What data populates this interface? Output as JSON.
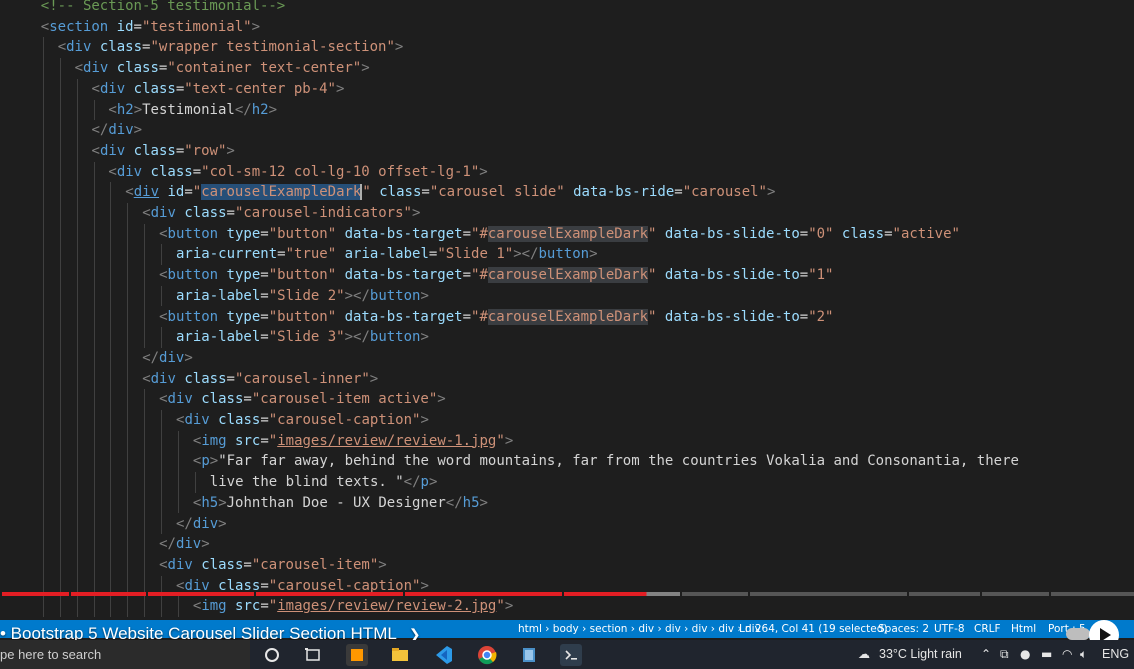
{
  "editor": {
    "lines": [
      {
        "indent": 2,
        "tokens": [
          {
            "t": "<!-- Section-5 testimonial-->",
            "c": "c"
          }
        ]
      },
      {
        "indent": 2,
        "tokens": [
          {
            "t": "<",
            "c": "p"
          },
          {
            "t": "section",
            "c": "t"
          },
          {
            "t": " id",
            "c": "a"
          },
          {
            "t": "=",
            "c": "x"
          },
          {
            "t": "\"testimonial\"",
            "c": "s"
          },
          {
            "t": ">",
            "c": "p"
          }
        ]
      },
      {
        "indent": 3,
        "tokens": [
          {
            "t": "<",
            "c": "p"
          },
          {
            "t": "div",
            "c": "t"
          },
          {
            "t": " class",
            "c": "a"
          },
          {
            "t": "=",
            "c": "x"
          },
          {
            "t": "\"wrapper testimonial-section\"",
            "c": "s"
          },
          {
            "t": ">",
            "c": "p"
          }
        ]
      },
      {
        "indent": 4,
        "tokens": [
          {
            "t": "<",
            "c": "p"
          },
          {
            "t": "div",
            "c": "t"
          },
          {
            "t": " class",
            "c": "a"
          },
          {
            "t": "=",
            "c": "x"
          },
          {
            "t": "\"container text-center\"",
            "c": "s"
          },
          {
            "t": ">",
            "c": "p"
          }
        ]
      },
      {
        "indent": 5,
        "tokens": [
          {
            "t": "<",
            "c": "p"
          },
          {
            "t": "div",
            "c": "t"
          },
          {
            "t": " class",
            "c": "a"
          },
          {
            "t": "=",
            "c": "x"
          },
          {
            "t": "\"text-center pb-4\"",
            "c": "s"
          },
          {
            "t": ">",
            "c": "p"
          }
        ]
      },
      {
        "indent": 6,
        "tokens": [
          {
            "t": "<",
            "c": "p"
          },
          {
            "t": "h2",
            "c": "t"
          },
          {
            "t": ">",
            "c": "p"
          },
          {
            "t": "Testimonial",
            "c": "x"
          },
          {
            "t": "</",
            "c": "p"
          },
          {
            "t": "h2",
            "c": "t"
          },
          {
            "t": ">",
            "c": "p"
          }
        ]
      },
      {
        "indent": 5,
        "tokens": [
          {
            "t": "</",
            "c": "p"
          },
          {
            "t": "div",
            "c": "t"
          },
          {
            "t": ">",
            "c": "p"
          }
        ]
      },
      {
        "indent": 5,
        "tokens": [
          {
            "t": "<",
            "c": "p"
          },
          {
            "t": "div",
            "c": "t"
          },
          {
            "t": " class",
            "c": "a"
          },
          {
            "t": "=",
            "c": "x"
          },
          {
            "t": "\"row\"",
            "c": "s"
          },
          {
            "t": ">",
            "c": "p"
          }
        ]
      },
      {
        "indent": 6,
        "tokens": [
          {
            "t": "<",
            "c": "p"
          },
          {
            "t": "div",
            "c": "t"
          },
          {
            "t": " class",
            "c": "a"
          },
          {
            "t": "=",
            "c": "x"
          },
          {
            "t": "\"col-sm-12 col-lg-10 offset-lg-1\"",
            "c": "s"
          },
          {
            "t": ">",
            "c": "p"
          }
        ]
      },
      {
        "indent": 7,
        "tokens": [
          {
            "t": "<",
            "c": "p"
          },
          {
            "t": "div",
            "c": "t u"
          },
          {
            "t": " id",
            "c": "a"
          },
          {
            "t": "=",
            "c": "x"
          },
          {
            "t": "\"",
            "c": "s"
          },
          {
            "t": "carouselExampleDark",
            "c": "s sel"
          },
          {
            "t": "|",
            "c": "cursor"
          },
          {
            "t": "\"",
            "c": "s"
          },
          {
            "t": " class",
            "c": "a"
          },
          {
            "t": "=",
            "c": "x"
          },
          {
            "t": "\"carousel slide\"",
            "c": "s"
          },
          {
            "t": " data-bs-ride",
            "c": "a"
          },
          {
            "t": "=",
            "c": "x"
          },
          {
            "t": "\"carousel\"",
            "c": "s"
          },
          {
            "t": ">",
            "c": "p"
          }
        ]
      },
      {
        "indent": 8,
        "tokens": [
          {
            "t": "<",
            "c": "p"
          },
          {
            "t": "div",
            "c": "t"
          },
          {
            "t": " class",
            "c": "a"
          },
          {
            "t": "=",
            "c": "x"
          },
          {
            "t": "\"carousel-indicators\"",
            "c": "s"
          },
          {
            "t": ">",
            "c": "p"
          }
        ]
      },
      {
        "indent": 9,
        "tokens": [
          {
            "t": "<",
            "c": "p"
          },
          {
            "t": "button",
            "c": "t"
          },
          {
            "t": " type",
            "c": "a"
          },
          {
            "t": "=",
            "c": "x"
          },
          {
            "t": "\"button\"",
            "c": "s"
          },
          {
            "t": " data-bs-target",
            "c": "a"
          },
          {
            "t": "=",
            "c": "x"
          },
          {
            "t": "\"#",
            "c": "s"
          },
          {
            "t": "carouselExampleDark",
            "c": "s hl"
          },
          {
            "t": "\"",
            "c": "s"
          },
          {
            "t": " data-bs-slide-to",
            "c": "a"
          },
          {
            "t": "=",
            "c": "x"
          },
          {
            "t": "\"0\"",
            "c": "s"
          },
          {
            "t": " class",
            "c": "a"
          },
          {
            "t": "=",
            "c": "x"
          },
          {
            "t": "\"active\"",
            "c": "s"
          }
        ]
      },
      {
        "indent": 10,
        "tokens": [
          {
            "t": "aria-current",
            "c": "a"
          },
          {
            "t": "=",
            "c": "x"
          },
          {
            "t": "\"true\"",
            "c": "s"
          },
          {
            "t": " aria-label",
            "c": "a"
          },
          {
            "t": "=",
            "c": "x"
          },
          {
            "t": "\"Slide 1\"",
            "c": "s"
          },
          {
            "t": "></",
            "c": "p"
          },
          {
            "t": "button",
            "c": "t"
          },
          {
            "t": ">",
            "c": "p"
          }
        ]
      },
      {
        "indent": 9,
        "tokens": [
          {
            "t": "<",
            "c": "p"
          },
          {
            "t": "button",
            "c": "t"
          },
          {
            "t": " type",
            "c": "a"
          },
          {
            "t": "=",
            "c": "x"
          },
          {
            "t": "\"button\"",
            "c": "s"
          },
          {
            "t": " data-bs-target",
            "c": "a"
          },
          {
            "t": "=",
            "c": "x"
          },
          {
            "t": "\"#",
            "c": "s"
          },
          {
            "t": "carouselExampleDark",
            "c": "s hl"
          },
          {
            "t": "\"",
            "c": "s"
          },
          {
            "t": " data-bs-slide-to",
            "c": "a"
          },
          {
            "t": "=",
            "c": "x"
          },
          {
            "t": "\"1\"",
            "c": "s"
          }
        ]
      },
      {
        "indent": 10,
        "tokens": [
          {
            "t": "aria-label",
            "c": "a"
          },
          {
            "t": "=",
            "c": "x"
          },
          {
            "t": "\"Slide 2\"",
            "c": "s"
          },
          {
            "t": "></",
            "c": "p"
          },
          {
            "t": "button",
            "c": "t"
          },
          {
            "t": ">",
            "c": "p"
          }
        ]
      },
      {
        "indent": 9,
        "tokens": [
          {
            "t": "<",
            "c": "p"
          },
          {
            "t": "button",
            "c": "t"
          },
          {
            "t": " type",
            "c": "a"
          },
          {
            "t": "=",
            "c": "x"
          },
          {
            "t": "\"button\"",
            "c": "s"
          },
          {
            "t": " data-bs-target",
            "c": "a"
          },
          {
            "t": "=",
            "c": "x"
          },
          {
            "t": "\"#",
            "c": "s"
          },
          {
            "t": "carouselExampleDark",
            "c": "s hl"
          },
          {
            "t": "\"",
            "c": "s"
          },
          {
            "t": " data-bs-slide-to",
            "c": "a"
          },
          {
            "t": "=",
            "c": "x"
          },
          {
            "t": "\"2\"",
            "c": "s"
          }
        ]
      },
      {
        "indent": 10,
        "tokens": [
          {
            "t": "aria-label",
            "c": "a"
          },
          {
            "t": "=",
            "c": "x"
          },
          {
            "t": "\"Slide 3\"",
            "c": "s"
          },
          {
            "t": "></",
            "c": "p"
          },
          {
            "t": "button",
            "c": "t"
          },
          {
            "t": ">",
            "c": "p"
          }
        ]
      },
      {
        "indent": 8,
        "tokens": [
          {
            "t": "</",
            "c": "p"
          },
          {
            "t": "div",
            "c": "t"
          },
          {
            "t": ">",
            "c": "p"
          }
        ]
      },
      {
        "indent": 8,
        "tokens": [
          {
            "t": "<",
            "c": "p"
          },
          {
            "t": "div",
            "c": "t"
          },
          {
            "t": " class",
            "c": "a"
          },
          {
            "t": "=",
            "c": "x"
          },
          {
            "t": "\"carousel-inner\"",
            "c": "s"
          },
          {
            "t": ">",
            "c": "p"
          }
        ]
      },
      {
        "indent": 9,
        "tokens": [
          {
            "t": "<",
            "c": "p"
          },
          {
            "t": "div",
            "c": "t"
          },
          {
            "t": " class",
            "c": "a"
          },
          {
            "t": "=",
            "c": "x"
          },
          {
            "t": "\"carousel-item active\"",
            "c": "s"
          },
          {
            "t": ">",
            "c": "p"
          }
        ]
      },
      {
        "indent": 10,
        "tokens": [
          {
            "t": "<",
            "c": "p"
          },
          {
            "t": "div",
            "c": "t"
          },
          {
            "t": " class",
            "c": "a"
          },
          {
            "t": "=",
            "c": "x"
          },
          {
            "t": "\"carousel-caption\"",
            "c": "s"
          },
          {
            "t": ">",
            "c": "p"
          }
        ]
      },
      {
        "indent": 11,
        "tokens": [
          {
            "t": "<",
            "c": "p"
          },
          {
            "t": "img",
            "c": "t"
          },
          {
            "t": " src",
            "c": "a"
          },
          {
            "t": "=",
            "c": "x"
          },
          {
            "t": "\"",
            "c": "s"
          },
          {
            "t": "images/review/review-1.jpg",
            "c": "s u"
          },
          {
            "t": "\"",
            "c": "s"
          },
          {
            "t": ">",
            "c": "p"
          }
        ]
      },
      {
        "indent": 11,
        "tokens": [
          {
            "t": "<",
            "c": "p"
          },
          {
            "t": "p",
            "c": "t"
          },
          {
            "t": ">",
            "c": "p"
          },
          {
            "t": "\"Far far away, behind the word mountains, far from the countries Vokalia and Consonantia, there",
            "c": "x"
          }
        ]
      },
      {
        "indent": 12,
        "tokens": [
          {
            "t": "live the blind texts. \"",
            "c": "x"
          },
          {
            "t": "</",
            "c": "p"
          },
          {
            "t": "p",
            "c": "t"
          },
          {
            "t": ">",
            "c": "p"
          }
        ]
      },
      {
        "indent": 11,
        "tokens": [
          {
            "t": "<",
            "c": "p"
          },
          {
            "t": "h5",
            "c": "t"
          },
          {
            "t": ">",
            "c": "p"
          },
          {
            "t": "Johnthan Doe - UX Designer",
            "c": "x"
          },
          {
            "t": "</",
            "c": "p"
          },
          {
            "t": "h5",
            "c": "t"
          },
          {
            "t": ">",
            "c": "p"
          }
        ]
      },
      {
        "indent": 10,
        "tokens": [
          {
            "t": "</",
            "c": "p"
          },
          {
            "t": "div",
            "c": "t"
          },
          {
            "t": ">",
            "c": "p"
          }
        ]
      },
      {
        "indent": 9,
        "tokens": [
          {
            "t": "</",
            "c": "p"
          },
          {
            "t": "div",
            "c": "t"
          },
          {
            "t": ">",
            "c": "p"
          }
        ]
      },
      {
        "indent": 9,
        "tokens": [
          {
            "t": "<",
            "c": "p"
          },
          {
            "t": "div",
            "c": "t"
          },
          {
            "t": " class",
            "c": "a"
          },
          {
            "t": "=",
            "c": "x"
          },
          {
            "t": "\"carousel-item\"",
            "c": "s"
          },
          {
            "t": ">",
            "c": "p"
          }
        ]
      },
      {
        "indent": 10,
        "tokens": [
          {
            "t": "<",
            "c": "p"
          },
          {
            "t": "div",
            "c": "t"
          },
          {
            "t": " class",
            "c": "a"
          },
          {
            "t": "=",
            "c": "x"
          },
          {
            "t": "\"carousel-caption\"",
            "c": "s"
          },
          {
            "t": ">",
            "c": "p"
          }
        ]
      },
      {
        "indent": 11,
        "tokens": [
          {
            "t": "<",
            "c": "p"
          },
          {
            "t": "img",
            "c": "t"
          },
          {
            "t": " src",
            "c": "a"
          },
          {
            "t": "=",
            "c": "x"
          },
          {
            "t": "\"",
            "c": "s"
          },
          {
            "t": "images/review/review-2.jpg",
            "c": "s u"
          },
          {
            "t": "\"",
            "c": "s"
          },
          {
            "t": ">",
            "c": "p"
          }
        ]
      }
    ]
  },
  "video": {
    "title": "• Bootstrap 5 Website Carousel Slider Section HTML",
    "chevron": "❯",
    "watched_fraction": 0.57
  },
  "statusbar": {
    "breadcrumb": "html › body › section › div › div › div › div › div",
    "position": "Ln 264, Col 41 (19 selected)",
    "spaces": "Spaces: 2",
    "encoding": "UTF-8",
    "eol": "CRLF",
    "language": "Html",
    "port": "Port : 5"
  },
  "taskbar": {
    "search_placeholder": "pe here to search",
    "weather": "33°C  Light rain",
    "language": "ENG",
    "apps": [
      "task-view",
      "file-explorer",
      "vscode",
      "chrome",
      "notepad",
      "terminal"
    ]
  },
  "colors": {
    "background": "#1e1e1e",
    "tag": "#569cd6",
    "attribute": "#9cdcfe",
    "string": "#ce9178",
    "punctuation": "#808080",
    "comment": "#6a9955",
    "selection": "#264f78",
    "statusbar": "#007acc",
    "progress_played": "#e31e24",
    "taskbar": "#20252e"
  }
}
